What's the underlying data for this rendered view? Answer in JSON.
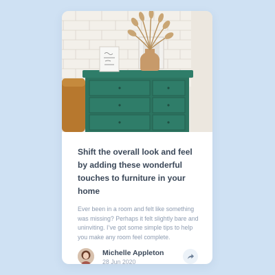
{
  "article": {
    "headline": "Shift the overall look and feel by adding these wonderful touches to furniture in your home",
    "excerpt": "Ever been in a room and felt like something was missing? Perhaps it felt slightly bare and uninviting. I’ve got some simple tips to help you make any room feel complete."
  },
  "author": {
    "name": "Michelle Appleton",
    "date": "28 Jun 2020"
  },
  "icons": {
    "share": "share-icon"
  },
  "colors": {
    "background": "#cfe1f3",
    "card": "#ffffff",
    "headline": "#3a4758",
    "excerpt": "#8d9bb0",
    "share_button": "#ecf2f8",
    "share_icon": "#6e8098"
  }
}
